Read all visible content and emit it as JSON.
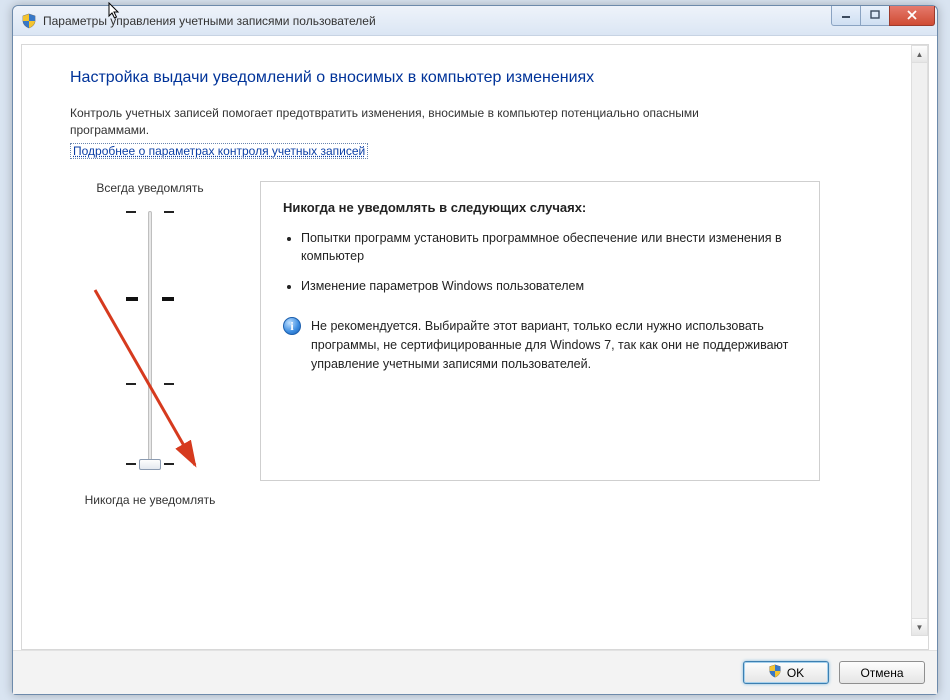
{
  "window": {
    "title": "Параметры управления учетными записями пользователей"
  },
  "page": {
    "heading": "Настройка выдачи уведомлений о вносимых в компьютер изменениях",
    "description": "Контроль учетных записей помогает предотвратить изменения, вносимые в компьютер потенциально опасными программами.",
    "link": "Подробнее о параметрах контроля учетных записей"
  },
  "slider": {
    "top_label": "Всегда уведомлять",
    "bottom_label": "Никогда не уведомлять",
    "levels": 4,
    "current_level": 0
  },
  "panel": {
    "heading": "Никогда не уведомлять в следующих случаях:",
    "bullets": [
      "Попытки программ установить программное обеспечение или внести изменения в компьютер",
      "Изменение параметров Windows пользователем"
    ],
    "info_icon": "i",
    "info_text": "Не рекомендуется. Выбирайте этот вариант, только если нужно использовать программы, не сертифицированные для Windows 7, так как они не поддерживают управление учетными записями пользователей."
  },
  "buttons": {
    "ok": "OK",
    "cancel": "Отмена"
  }
}
